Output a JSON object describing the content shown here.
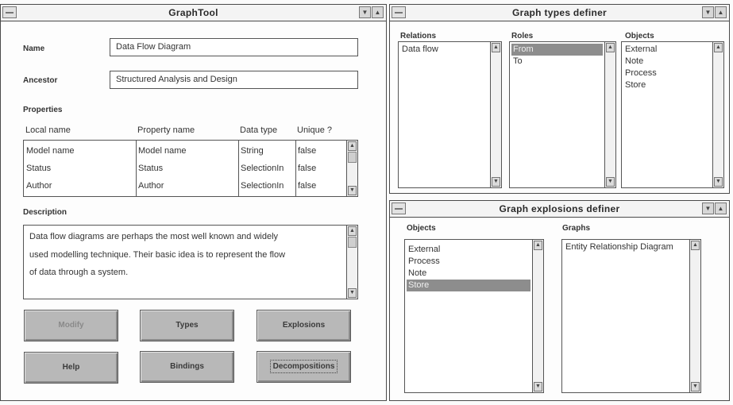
{
  "graphtool": {
    "title": "GraphTool",
    "name_label": "Name",
    "name_value": "Data Flow Diagram",
    "ancestor_label": "Ancestor",
    "ancestor_value": "Structured Analysis and Design",
    "properties_label": "Properties",
    "columns": [
      "Local name",
      "Property name",
      "Data type",
      "Unique ?"
    ],
    "rows": [
      [
        "Model name",
        "Model name",
        "String",
        "false"
      ],
      [
        "Status",
        "Status",
        "SelectionIn",
        "false"
      ],
      [
        "Author",
        "Author",
        "SelectionIn",
        "false"
      ]
    ],
    "description_label": "Description",
    "description_lines": [
      "Data flow diagrams are perhaps the most well known and widely",
      "used modelling technique. Their basic idea is to represent the flow",
      "of data through a system."
    ],
    "buttons": {
      "modify": "Modify",
      "types": "Types",
      "explosions": "Explosions",
      "help": "Help",
      "bindings": "Bindings",
      "decompositions": "Decompositions"
    }
  },
  "types_definer": {
    "title": "Graph types definer",
    "relations_label": "Relations",
    "relations": [
      "Data flow"
    ],
    "roles_label": "Roles",
    "roles": [
      "From",
      "To"
    ],
    "roles_selected": "From",
    "objects_label": "Objects",
    "objects": [
      "External",
      "Note",
      "Process",
      "Store"
    ]
  },
  "explosions_definer": {
    "title": "Graph explosions definer",
    "objects_label": "Objects",
    "objects": [
      "External",
      "Process",
      "Note",
      "Store"
    ],
    "objects_selected": "Store",
    "graphs_label": "Graphs",
    "graphs": [
      "Entity Relationship Diagram"
    ]
  },
  "icons": {
    "system_menu": "system-menu-icon",
    "minimize": "minimize-arrow-icon",
    "maximize": "maximize-arrow-icon",
    "scroll_up": "scroll-up-arrow-icon",
    "scroll_down": "scroll-down-arrow-icon"
  }
}
